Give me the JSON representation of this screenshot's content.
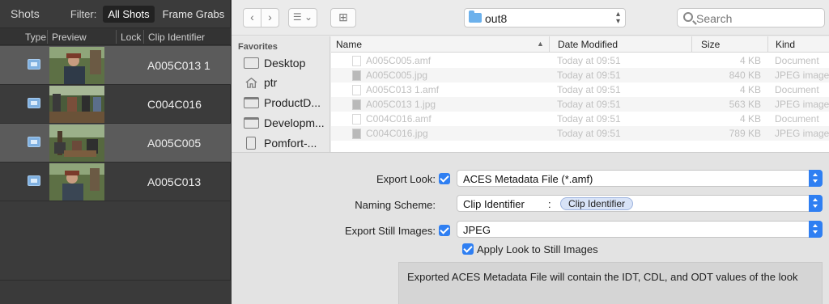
{
  "shots_panel": {
    "title": "Shots",
    "filter_label": "Filter:",
    "filter_all": "All Shots",
    "filter_grabs": "Frame Grabs",
    "columns": {
      "type": "Type",
      "preview": "Preview",
      "lock": "Lock",
      "clip_id": "Clip Identifier"
    },
    "rows": [
      {
        "clip_id": "A005C013 1",
        "selected": true
      },
      {
        "clip_id": "C004C016",
        "selected": false
      },
      {
        "clip_id": "A005C005",
        "selected": true
      },
      {
        "clip_id": "A005C013",
        "selected": false
      }
    ]
  },
  "finder": {
    "back_label": "‹",
    "forward_label": "›",
    "view_label": "☰ ⌄",
    "new_folder_label": "⊞",
    "path": "out8",
    "search_placeholder": "Search",
    "favorites_heading": "Favorites",
    "favorites": [
      {
        "label": "Desktop",
        "icon": "desktop-icon"
      },
      {
        "label": "ptr",
        "icon": "home-icon"
      },
      {
        "label": "ProductD...",
        "icon": "folder-icon"
      },
      {
        "label": "Developm...",
        "icon": "folder-icon"
      },
      {
        "label": "Pomfort-...",
        "icon": "document-icon"
      }
    ],
    "columns": {
      "name": "Name",
      "date": "Date Modified",
      "size": "Size",
      "kind": "Kind"
    },
    "files": [
      {
        "name": "A005C005.amf",
        "date": "Today at 09:51",
        "size": "4 KB",
        "kind": "Document",
        "icon": "document-icon"
      },
      {
        "name": "A005C005.jpg",
        "date": "Today at 09:51",
        "size": "840 KB",
        "kind": "JPEG image",
        "icon": "image-icon"
      },
      {
        "name": "A005C013 1.amf",
        "date": "Today at 09:51",
        "size": "4 KB",
        "kind": "Document",
        "icon": "document-icon"
      },
      {
        "name": "A005C013 1.jpg",
        "date": "Today at 09:51",
        "size": "563 KB",
        "kind": "JPEG image",
        "icon": "image-icon"
      },
      {
        "name": "C004C016.amf",
        "date": "Today at 09:51",
        "size": "4 KB",
        "kind": "Document",
        "icon": "document-icon"
      },
      {
        "name": "C004C016.jpg",
        "date": "Today at 09:51",
        "size": "789 KB",
        "kind": "JPEG image",
        "icon": "image-icon"
      }
    ]
  },
  "export_options": {
    "export_look_label": "Export Look:",
    "export_look_checked": true,
    "export_look_value": "ACES Metadata File (*.amf)",
    "naming_label": "Naming Scheme:",
    "naming_prefix": "Clip Identifier",
    "naming_colon": ":",
    "naming_token": "Clip Identifier",
    "still_label": "Export Still Images:",
    "still_checked": true,
    "still_value": "JPEG",
    "apply_look_label": "Apply Look to Still Images",
    "apply_look_checked": true,
    "info_text": "Exported ACES Metadata File will contain the IDT, CDL, and ODT values of the look"
  },
  "colors": {
    "accent": "#2f7ff2",
    "selected_row": "#5b5b5b",
    "panel_dark": "#3b3b3b"
  }
}
